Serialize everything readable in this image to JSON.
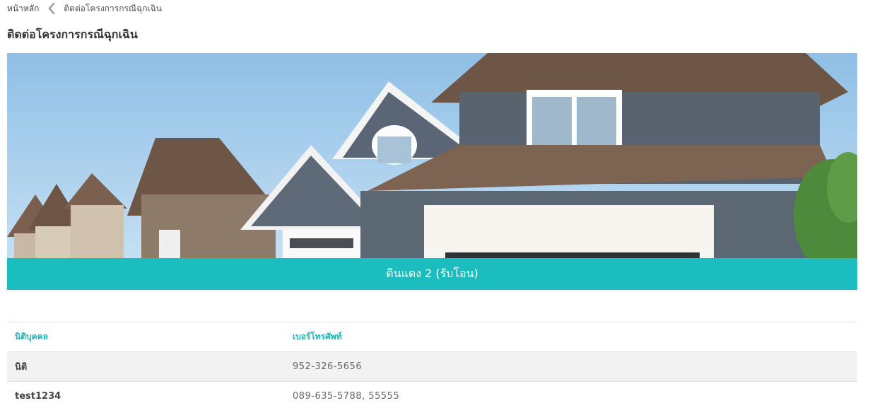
{
  "breadcrumb": {
    "home_label": "หน้าหลัก",
    "separator_icon": "chevron-left-icon",
    "current_label": "ติดต่อโครงการกรณีฉุกเฉิน"
  },
  "page_title": "ติดต่อโครงการกรณีฉุกเฉิน",
  "banner": {
    "image": "house-photo",
    "caption": "ดินแดง 2 (รับโอน)"
  },
  "colors": {
    "accent": "#1bbdbf",
    "header_text": "#1bb3b5",
    "row_alt": "#f2f2f2"
  },
  "table": {
    "columns": [
      "นิติบุคคล",
      "เบอร์โทรศัพท์"
    ],
    "rows": [
      {
        "name": "นิติ",
        "phone": "952-326-5656"
      },
      {
        "name": "test1234",
        "phone": "089-635-5788, 55555"
      }
    ]
  }
}
